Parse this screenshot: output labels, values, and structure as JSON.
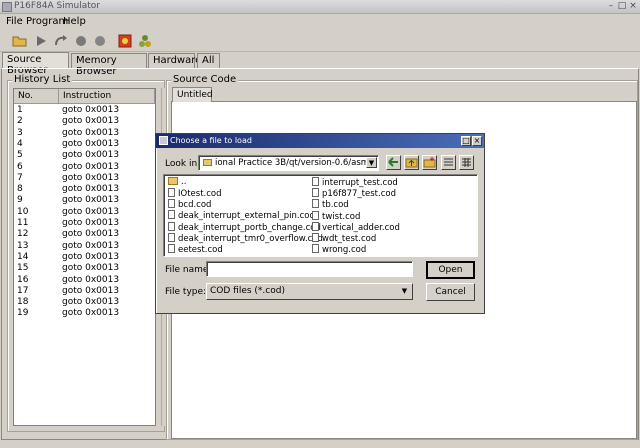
{
  "window": {
    "title": "P16F84A Simulator"
  },
  "menu": [
    {
      "label": "File"
    },
    {
      "label": "Program"
    },
    {
      "label": "Help"
    }
  ],
  "tabs": [
    {
      "label": "Source Browser"
    },
    {
      "label": "Memory Browser"
    },
    {
      "label": "Hardware"
    },
    {
      "label": "All"
    }
  ],
  "history": {
    "title": "History List",
    "columns": [
      "No.",
      "Instruction"
    ],
    "rows": [
      {
        "no": "1",
        "ins": "goto 0x0013"
      },
      {
        "no": "2",
        "ins": "goto 0x0013"
      },
      {
        "no": "3",
        "ins": "goto 0x0013"
      },
      {
        "no": "4",
        "ins": "goto 0x0013"
      },
      {
        "no": "5",
        "ins": "goto 0x0013"
      },
      {
        "no": "6",
        "ins": "goto 0x0013"
      },
      {
        "no": "7",
        "ins": "goto 0x0013"
      },
      {
        "no": "8",
        "ins": "goto 0x0013"
      },
      {
        "no": "9",
        "ins": "goto 0x0013"
      },
      {
        "no": "10",
        "ins": "goto 0x0013"
      },
      {
        "no": "11",
        "ins": "goto 0x0013"
      },
      {
        "no": "12",
        "ins": "goto 0x0013"
      },
      {
        "no": "13",
        "ins": "goto 0x0013"
      },
      {
        "no": "14",
        "ins": "goto 0x0013"
      },
      {
        "no": "15",
        "ins": "goto 0x0013"
      },
      {
        "no": "16",
        "ins": "goto 0x0013"
      },
      {
        "no": "17",
        "ins": "goto 0x0013"
      },
      {
        "no": "18",
        "ins": "goto 0x0013"
      },
      {
        "no": "19",
        "ins": "goto 0x0013"
      }
    ]
  },
  "source": {
    "title": "Source Code",
    "tab": "Untitled"
  },
  "dialog": {
    "title": "Choose a file to load",
    "look_in_label": "Look in:",
    "look_in_value": "ional Practice 3B/qt/version-0.6/asmcode/",
    "parent_entry": "..",
    "files_left": [
      "IOtest.cod",
      "bcd.cod",
      "deak_interrupt_external_pin.cod",
      "deak_interrupt_portb_change.cod",
      "deak_interrupt_tmr0_overflow.cod",
      "eetest.cod"
    ],
    "files_right": [
      "interrupt_test.cod",
      "p16f877_test.cod",
      "tb.cod",
      "twist.cod",
      "vertical_adder.cod",
      "wdt_test.cod",
      "wrong.cod"
    ],
    "file_name_label": "File name:",
    "file_name_value": "",
    "file_type_label": "File type:",
    "file_type_value": "COD files (*.cod)",
    "open_label": "Open",
    "cancel_label": "Cancel"
  },
  "colors": {
    "dialog_title": "#1a2a6c",
    "face": "#d4d0c8"
  }
}
